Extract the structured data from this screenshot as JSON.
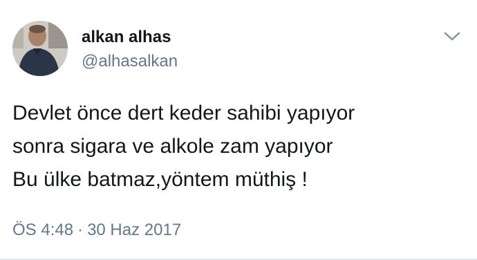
{
  "tweet": {
    "author": {
      "display_name": "alkan alhas",
      "handle": "@alhasalkan"
    },
    "text_lines": [
      "Devlet önce dert keder sahibi yapıyor",
      "sonra sigara ve alkole zam yapıyor",
      "Bu ülke batmaz,yöntem müthiş !"
    ],
    "time": "ÖS 4:48",
    "separator": "·",
    "date": "30 Haz 2017",
    "menu_icon": "chevron-down-icon"
  },
  "colors": {
    "text": "#14171a",
    "secondary": "#657786",
    "chevron": "#8899a6"
  }
}
